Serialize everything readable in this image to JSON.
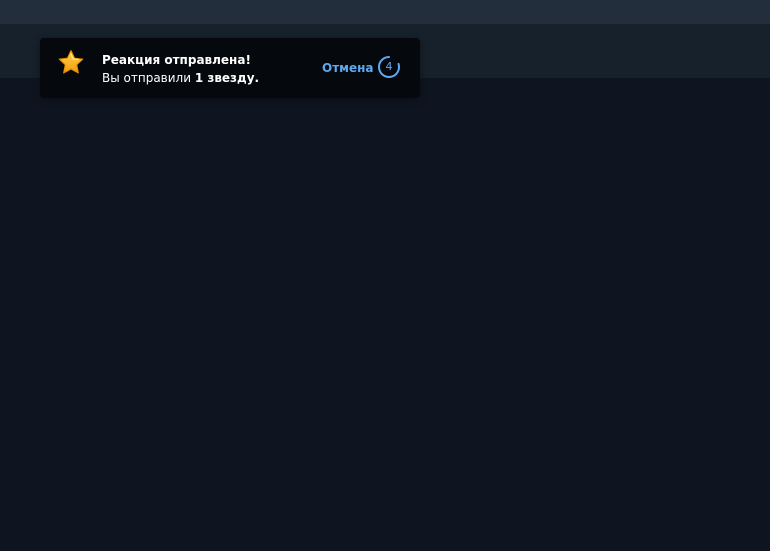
{
  "toast": {
    "icon": "star-icon",
    "title": "Реакция отправлена!",
    "body_prefix": "Вы отправили ",
    "body_emphasis": "1 звезду.",
    "undo_label": "Отмена",
    "countdown": "4",
    "countdown_remaining_fraction": 0.8,
    "accent_color": "#5ea9f0"
  }
}
